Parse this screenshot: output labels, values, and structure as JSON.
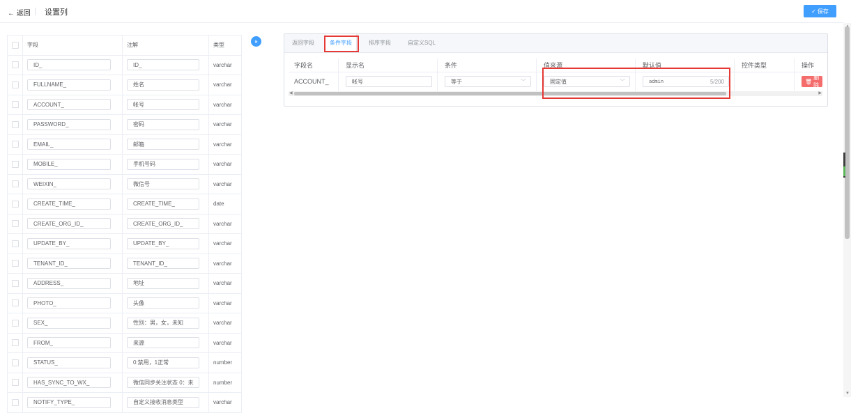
{
  "header": {
    "back_label": "← 返回",
    "title": "设置列",
    "save_label": "保存",
    "save_icon": "check-icon"
  },
  "left_table": {
    "columns": [
      "字段",
      "注解",
      "类型"
    ],
    "rows": [
      {
        "field": "ID_",
        "comment": "ID_",
        "type": "varchar"
      },
      {
        "field": "FULLNAME_",
        "comment": "姓名",
        "type": "varchar"
      },
      {
        "field": "ACCOUNT_",
        "comment": "帐号",
        "type": "varchar"
      },
      {
        "field": "PASSWORD_",
        "comment": "密码",
        "type": "varchar"
      },
      {
        "field": "EMAIL_",
        "comment": "邮箱",
        "type": "varchar"
      },
      {
        "field": "MOBILE_",
        "comment": "手机号码",
        "type": "varchar"
      },
      {
        "field": "WEIXIN_",
        "comment": "微信号",
        "type": "varchar"
      },
      {
        "field": "CREATE_TIME_",
        "comment": "CREATE_TIME_",
        "type": "date"
      },
      {
        "field": "CREATE_ORG_ID_",
        "comment": "CREATE_ORG_ID_",
        "type": "varchar"
      },
      {
        "field": "UPDATE_BY_",
        "comment": "UPDATE_BY_",
        "type": "varchar"
      },
      {
        "field": "TENANT_ID_",
        "comment": "TENANT_ID_",
        "type": "varchar"
      },
      {
        "field": "ADDRESS_",
        "comment": "地址",
        "type": "varchar"
      },
      {
        "field": "PHOTO_",
        "comment": "头像",
        "type": "varchar"
      },
      {
        "field": "SEX_",
        "comment": "性别：男，女，未知",
        "type": "varchar"
      },
      {
        "field": "FROM_",
        "comment": "来源",
        "type": "varchar"
      },
      {
        "field": "STATUS_",
        "comment": "0:禁用，1正常",
        "type": "number"
      },
      {
        "field": "HAS_SYNC_TO_WX_",
        "comment": "微信同步关注状态 0：未",
        "type": "number"
      },
      {
        "field": "NOTIFY_TYPE_",
        "comment": "自定义接收消息类型",
        "type": "varchar"
      }
    ]
  },
  "expand_icon": "»",
  "tabs": [
    "返回字段",
    "条件字段",
    "排序字段",
    "自定义SQL"
  ],
  "active_tab": "条件字段",
  "condition_table": {
    "columns": [
      "字段名",
      "显示名",
      "条件",
      "值来源",
      "默认值",
      "控件类型",
      "操作"
    ],
    "row": {
      "field": "ACCOUNT_",
      "display": "帐号",
      "condition": "等于",
      "value_source": "固定值",
      "default_value": "admin",
      "char_count": "5/200",
      "control_type": "",
      "delete_label": "删除"
    }
  },
  "colors": {
    "accent": "#409eff",
    "danger": "#f56c6c",
    "highlight": "#e53935"
  }
}
